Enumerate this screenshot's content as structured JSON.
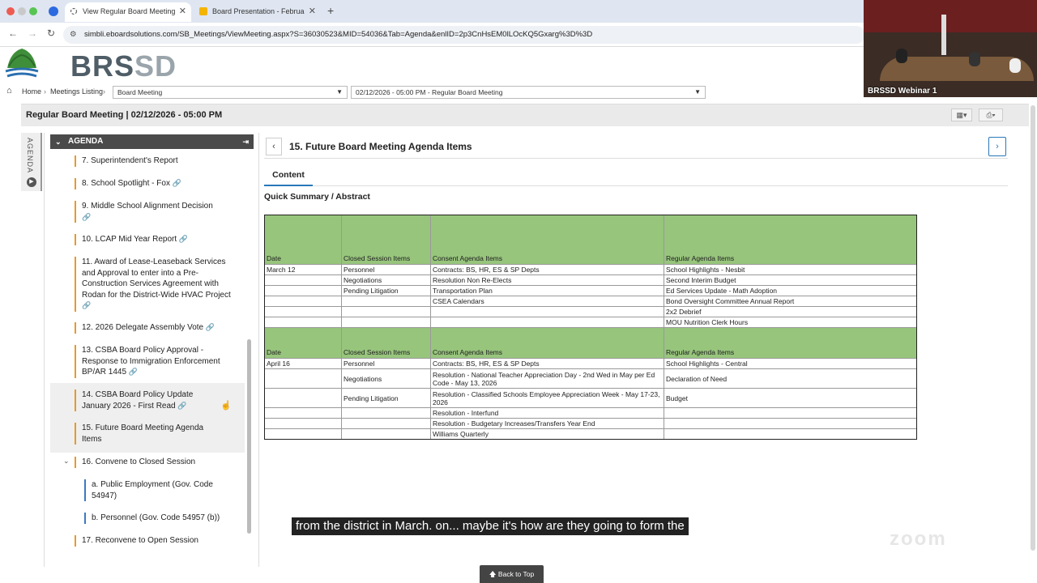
{
  "browser": {
    "tabs": [
      {
        "label": "View Regular Board Meeting"
      },
      {
        "label": "Board Presentation - Februa"
      }
    ],
    "new_tab": "+",
    "url": "simbli.eboardsolutions.com/SB_Meetings/ViewMeeting.aspx?S=36030523&MID=54036&Tab=Agenda&enlID=2p3CnHsEM0lLOcKQ5Gxarg%3D%3D"
  },
  "logo": {
    "text_dark": "BRS",
    "text_light": "SD"
  },
  "video": {
    "label": "BRSSD Webinar 1"
  },
  "breadcrumb": {
    "home": "Home",
    "listing": "Meetings Listing",
    "type_select": "Board Meeting",
    "meeting_select": "02/12/2026 - 05:00 PM - Regular Board Meeting"
  },
  "meeting_title": "Regular Board Meeting | 02/12/2026 - 05:00 PM",
  "sidebar": {
    "vertical_label": "AGENDA",
    "heading": "AGENDA",
    "items": [
      {
        "label": "7. Superintendent's Report"
      },
      {
        "label": "8. School Spotlight - Fox"
      },
      {
        "label": "9. Middle School Alignment Decision"
      },
      {
        "label": "10. LCAP Mid Year Report"
      },
      {
        "label": "11. Award of Lease-Leaseback Services and Approval to enter into a Pre-Construction Services Agreement with Rodan for the District-Wide HVAC Project"
      },
      {
        "label": "12. 2026 Delegate Assembly Vote"
      },
      {
        "label": "13. CSBA Board Policy Approval - Response to Immigration Enforcement BP/AR 1445"
      },
      {
        "label": "14. CSBA Board Policy Update January 2026 - First Read"
      },
      {
        "label": "15. Future Board Meeting Agenda Items"
      },
      {
        "label": "16. Convene to Closed Session"
      },
      {
        "label": "a. Public Employment (Gov. Code 54947)"
      },
      {
        "label": "b. Personnel (Gov. Code 54957 (b))"
      },
      {
        "label": "17. Reconvene to Open Session"
      }
    ]
  },
  "content": {
    "item_title": "15. Future Board Meeting Agenda Items",
    "tab": "Content",
    "section": "Quick Summary / Abstract",
    "table": {
      "headers": [
        "Date",
        "Closed Session Items",
        "Consent Agenda Items",
        "Regular Agenda Items"
      ],
      "block1": [
        [
          "March 12",
          "Personnel",
          "Contracts: BS, HR, ES & SP Depts",
          "School Highlights - Nesbit"
        ],
        [
          "",
          "Negotiations",
          "Resolution Non Re-Elects",
          "Second Interim Budget"
        ],
        [
          "",
          "Pending Litigation",
          "Transportation Plan",
          "Ed Services Update - Math Adoption"
        ],
        [
          "",
          "",
          "CSEA Calendars",
          "Bond Oversight Committee Annual Report"
        ],
        [
          "",
          "",
          "",
          "2x2 Debrief"
        ],
        [
          "",
          "",
          "",
          "MOU Nutrition Clerk Hours"
        ]
      ],
      "block2": [
        [
          "April 16",
          "Personnel",
          "Contracts: BS, HR, ES & SP Depts",
          "School Highlights - Central"
        ],
        [
          "",
          "Negotiations",
          "Resolution - National Teacher Appreciation Day - 2nd Wed in May per Ed Code - May 13, 2026",
          "Declaration of Need"
        ],
        [
          "",
          "Pending Litigation",
          "Resolution - Classified Schools Employee Appreciation Week - May 17-23, 2026",
          "Budget"
        ],
        [
          "",
          "",
          "Resolution - Interfund",
          ""
        ],
        [
          "",
          "",
          "Resolution - Budgetary Increases/Transfers Year End",
          ""
        ],
        [
          "",
          "",
          "Williams Quarterly",
          ""
        ]
      ]
    }
  },
  "caption": "from the district in March. on... maybe it's how are they going to form the",
  "back_to_top": "Back to Top",
  "colors": {
    "header_green": "#97c57c",
    "accent_blue": "#2a78b8",
    "item_orange": "#e59a2a"
  }
}
